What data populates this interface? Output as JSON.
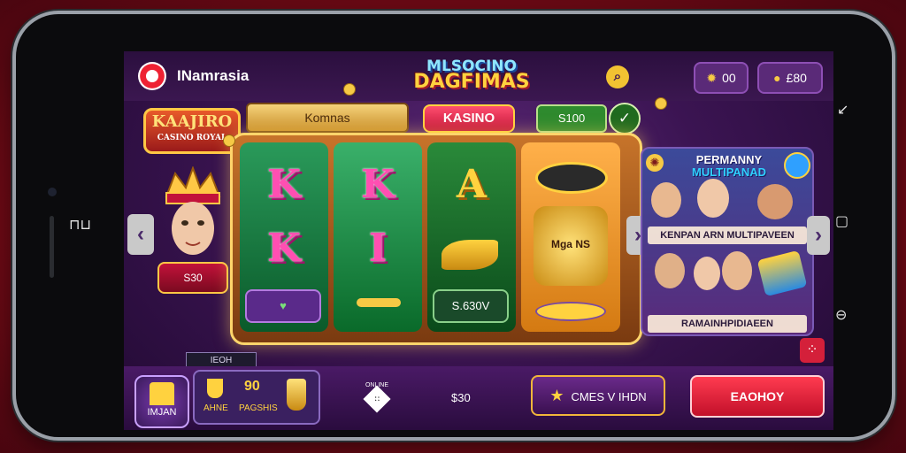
{
  "phone": {
    "side_left_glyph": "⊓⊔",
    "side_right_top": "↙",
    "side_right_mid": "▢",
    "side_right_bot": "⊖"
  },
  "app": {
    "brand_name": "INamrasia",
    "search_icon": "search-icon"
  },
  "header": {
    "coins_label": "00",
    "wallet_label": "£80",
    "game_title_line1": "MLSOCINO",
    "game_title_line2": "DAGFIMAS",
    "kasino_label": "KASINO",
    "info_bar_label": "Komnas",
    "credit_label": "S100",
    "credit_button_icon": "✓"
  },
  "left_panel": {
    "badge_title": "KAAJIRO",
    "badge_sub": "CASINO ROYAL",
    "prize_label": "S30"
  },
  "reels": {
    "r1_top": "K",
    "r1_bottom": "K",
    "r2_top": "K",
    "r2_bottom": "I",
    "r3_top": "A",
    "r3_button": "S.630V",
    "r4_mid": "Mga NS"
  },
  "promo": {
    "title_line1": "PERMANNY",
    "title_line2": "MULTIPANAD",
    "line_top": "KENPAN ARN MULTIPAVEEN",
    "line_bottom": "RAMAINHPIDIAEEN"
  },
  "bottom": {
    "tiny_tag": "IEOH",
    "lobby_label": "IMJAN",
    "group_left": "AHNE",
    "group_mid_top": "90",
    "group_mid_bot": "PAGSHIS",
    "dice_label": "ONLINE",
    "number": "$30",
    "games_label": "CMES V IHDN",
    "play_label": "EAOHOY"
  },
  "colors": {
    "accent_gold": "#ffd23f",
    "play_red": "#ff3b50",
    "screen_purple": "#3b1452"
  }
}
